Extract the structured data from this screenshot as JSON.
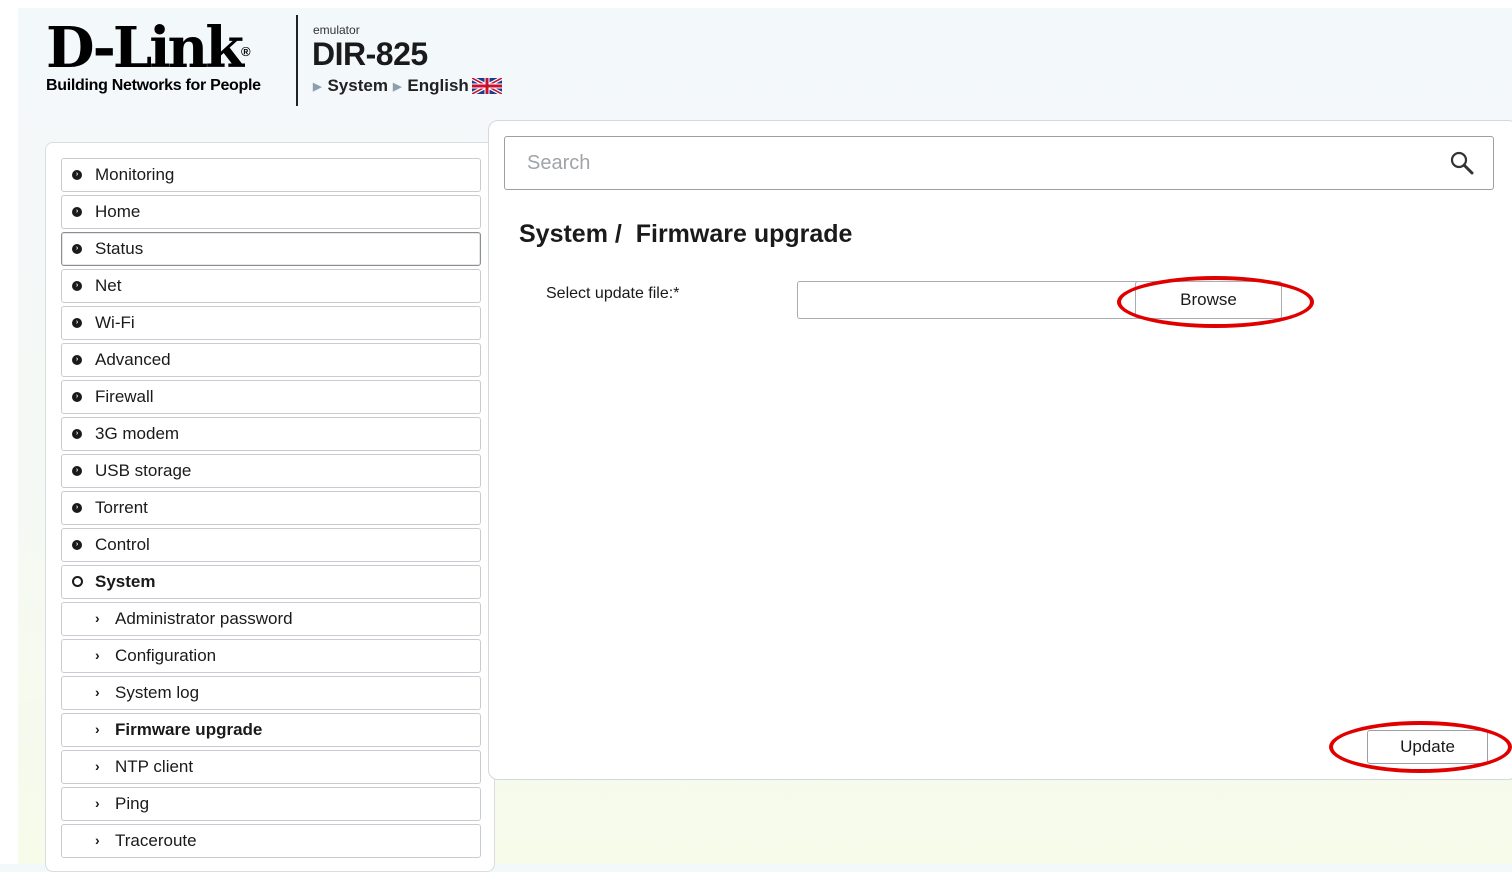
{
  "header": {
    "logo_text": "D-Link",
    "logo_registered": "®",
    "logo_tagline": "Building Networks for People",
    "emulator_label": "emulator",
    "model": "DIR-825",
    "breadcrumb": [
      "System",
      "English"
    ],
    "language_flag_icon": "uk-flag-icon"
  },
  "search": {
    "placeholder": "Search",
    "icon": "search-icon"
  },
  "sidebar": {
    "items": [
      {
        "label": "Monitoring"
      },
      {
        "label": "Home"
      },
      {
        "label": "Status"
      },
      {
        "label": "Net"
      },
      {
        "label": "Wi-Fi"
      },
      {
        "label": "Advanced"
      },
      {
        "label": "Firewall"
      },
      {
        "label": "3G modem"
      },
      {
        "label": "USB storage"
      },
      {
        "label": "Torrent"
      },
      {
        "label": "Control"
      },
      {
        "label": "System",
        "expanded": true
      }
    ],
    "system_subitems": [
      {
        "label": "Administrator password"
      },
      {
        "label": "Configuration"
      },
      {
        "label": "System log"
      },
      {
        "label": "Firmware upgrade",
        "selected": true
      },
      {
        "label": "NTP client"
      },
      {
        "label": "Ping"
      },
      {
        "label": "Traceroute"
      }
    ]
  },
  "main": {
    "title": "System /  Firmware upgrade",
    "file_label": "Select update file:*",
    "file_value": "",
    "browse_label": "Browse",
    "update_label": "Update"
  },
  "colors": {
    "highlight": "#e00000",
    "background_top": "#f3f8fb",
    "background_bottom": "#f6fbea"
  }
}
